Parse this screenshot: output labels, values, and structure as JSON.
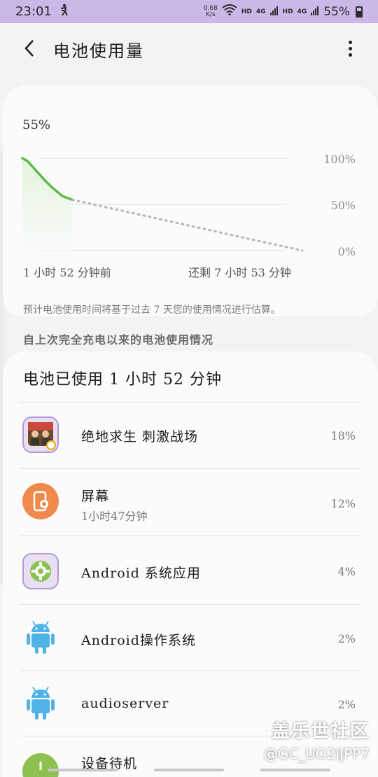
{
  "status_bar": {
    "time": "23:01",
    "net_speed_value": "0.68",
    "net_speed_unit": "K/s",
    "hd1": "HD",
    "lte1": "4G",
    "hd2": "HD",
    "lte2": "4G",
    "battery": "55%"
  },
  "header": {
    "title": "电池使用量"
  },
  "battery_chart": {
    "current_level": "55%",
    "tick_100": "100%",
    "tick_50": "50%",
    "tick_0": "0%",
    "time_start": "1 小时 52 分钟前",
    "time_end": "还剩 7 小时 53 分钟",
    "note": "预计电池使用时间将基于过去 7 天您的使用情况进行估算。",
    "colors": {
      "used": "#5fbb46",
      "used_fill": "#e3f3dc",
      "projected": "#b5b5b5"
    }
  },
  "chart_data": {
    "type": "line",
    "ylim": [
      0,
      100
    ],
    "tick_labels_y": [
      "100%",
      "50%",
      "0%"
    ],
    "tick_labels_x": [
      "1 小时 52 分钟前",
      "还剩 7 小时 53 分钟"
    ],
    "series": [
      {
        "points": [
          [
            0,
            100
          ],
          [
            10,
            97
          ],
          [
            25,
            88
          ],
          [
            45,
            76
          ],
          [
            60,
            68
          ],
          [
            80,
            59
          ],
          [
            100,
            55
          ]
        ]
      },
      {
        "points": [
          [
            100,
            55
          ],
          [
            560,
            0
          ]
        ]
      }
    ]
  },
  "usage": {
    "section_title": "自上次完全充电以来的电池使用情况",
    "summary": "电池已使用 1 小时 52 分钟",
    "items": [
      {
        "name": "绝地求生 刺激战场",
        "sub": "",
        "percent": "18%",
        "icon": "game-icon"
      },
      {
        "name": "屏幕",
        "sub": "1小时47分钟",
        "percent": "12%",
        "icon": "screen-icon"
      },
      {
        "name": "Android 系统应用",
        "sub": "",
        "percent": "4%",
        "icon": "settings-gear-icon"
      },
      {
        "name": "Android操作系统",
        "sub": "",
        "percent": "2%",
        "icon": "android-icon"
      },
      {
        "name": "audioserver",
        "sub": "",
        "percent": "2%",
        "icon": "android-icon"
      },
      {
        "name": "设备待机",
        "sub": "",
        "percent": "",
        "icon": "standby-icon"
      }
    ]
  },
  "watermark": {
    "title": "盖乐世社区",
    "handle": "@GC_UO2IJPP7"
  }
}
